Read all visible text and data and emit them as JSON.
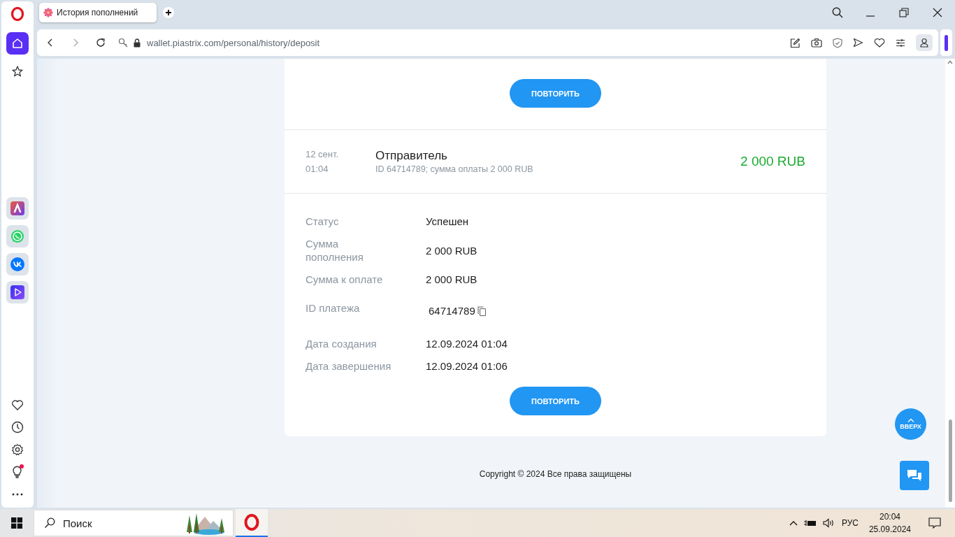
{
  "browser": {
    "tabs": [
      {
        "title": "История пополнений",
        "selected": true
      }
    ],
    "url": "wallet.piastrix.com/personal/history/deposit"
  },
  "sidebar": {
    "items": [
      {
        "kind": "home",
        "selected": true
      },
      {
        "kind": "bookmarks",
        "selected": false
      },
      {
        "kind": "aria",
        "selected": false
      },
      {
        "kind": "whatsapp",
        "selected": false
      },
      {
        "kind": "vk",
        "selected": false
      },
      {
        "kind": "player",
        "selected": false
      }
    ],
    "tools": [
      {
        "kind": "heart",
        "notification": false
      },
      {
        "kind": "history",
        "notification": false
      },
      {
        "kind": "settings",
        "notification": false
      },
      {
        "kind": "tips",
        "notification": true
      },
      {
        "kind": "more",
        "notification": false
      }
    ]
  },
  "history": {
    "previous": {
      "button": "ПОВТОРИТЬ"
    },
    "entries": [
      {
        "date": "12 сент.",
        "time": "01:04",
        "title": "Отправитель",
        "subtitle": "ID 64714789; сумма оплаты 2 000 RUB",
        "amount": "2 000 RUB",
        "expanded": true,
        "button": "ПОВТОРИТЬ",
        "details": [
          {
            "kind": "text",
            "label": "Статус",
            "value": "Успешен"
          },
          {
            "kind": "text",
            "label": "Сумма пополнения",
            "value": "2 000 RUB"
          },
          {
            "kind": "text",
            "label": "Сумма к оплате",
            "value": "2 000 RUB"
          },
          {
            "kind": "copy",
            "label": "ID платежа",
            "value": "64714789"
          },
          {
            "kind": "text",
            "label": "Дата создания",
            "value": "12.09.2024 01:04"
          },
          {
            "kind": "text",
            "label": "Дата завершения",
            "value": "12.09.2024 01:06"
          }
        ]
      }
    ]
  },
  "scroll_top": "ВВЕРХ",
  "copyright": "Copyright © 2024 Все права защищены",
  "taskbar": {
    "search_placeholder": "Поиск",
    "apps": [
      {
        "kind": "opera",
        "active": true
      }
    ],
    "language": "РУС",
    "time": "20:04",
    "date": "25.09.2024"
  }
}
